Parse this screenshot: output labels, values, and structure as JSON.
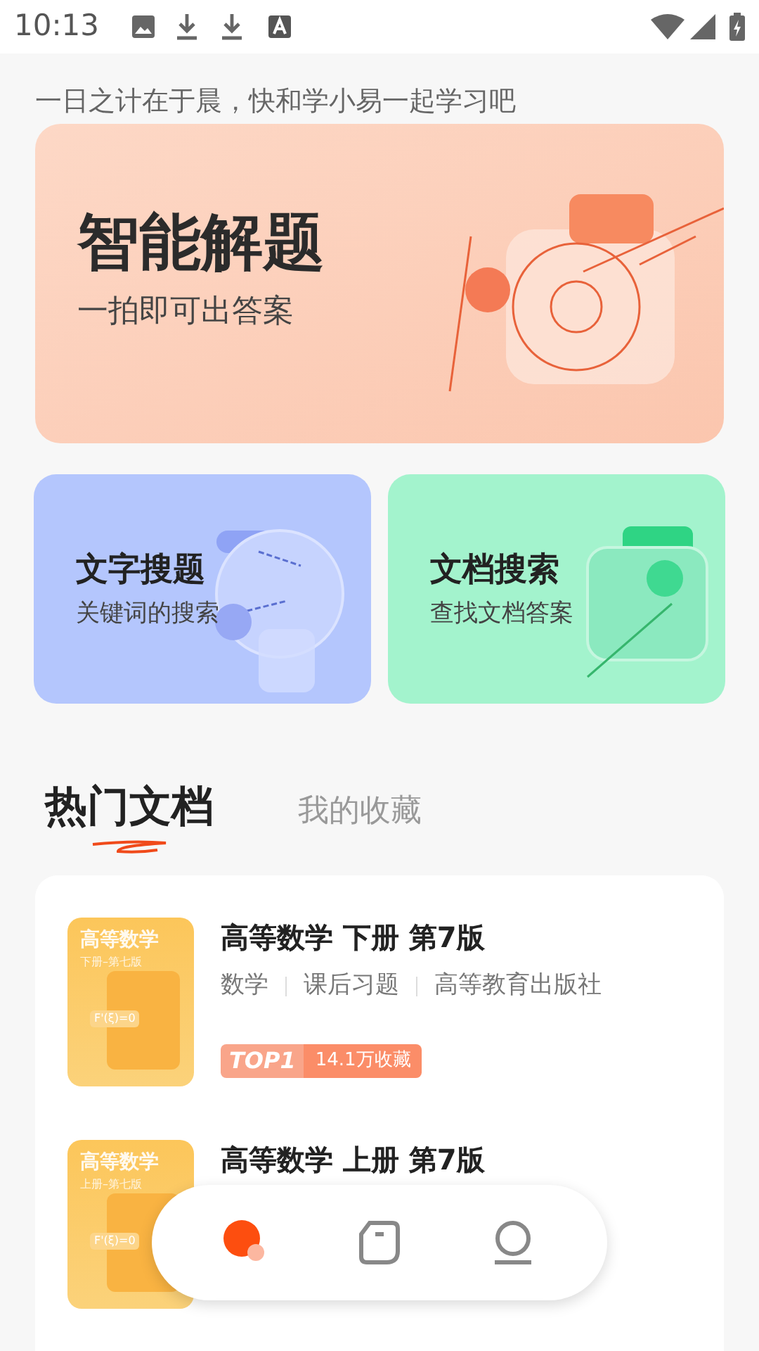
{
  "status_bar": {
    "time": "10:13"
  },
  "slogan": "一日之计在于晨，快和学小易一起学习吧",
  "hero": {
    "title": "智能解题",
    "subtitle": "一拍即可出答案"
  },
  "features": [
    {
      "kind": "text",
      "title": "文字搜题",
      "subtitle": "关键词的搜索"
    },
    {
      "kind": "doc",
      "title": "文档搜索",
      "subtitle": "查找文档答案"
    }
  ],
  "tabs": [
    {
      "label": "热门文档",
      "selected": true
    },
    {
      "label": "我的收藏",
      "selected": false
    }
  ],
  "documents": [
    {
      "cover_title": "高等数学",
      "cover_subtitle": "下册–第七版",
      "cover_formula": "F'(ξ)=0",
      "title": "高等数学 下册 第7版",
      "tags": [
        "数学",
        "课后习题",
        "高等教育出版社"
      ],
      "rank": "TOP1",
      "favorites": "14.1万收藏"
    },
    {
      "cover_title": "高等数学",
      "cover_subtitle": "上册–第七版",
      "cover_formula": "F'(ξ)=0",
      "title": "高等数学 上册 第7版"
    }
  ],
  "bottom_nav": [
    {
      "kind": "home",
      "selected": true
    },
    {
      "kind": "docs",
      "selected": false
    },
    {
      "kind": "profile",
      "selected": false
    }
  ]
}
